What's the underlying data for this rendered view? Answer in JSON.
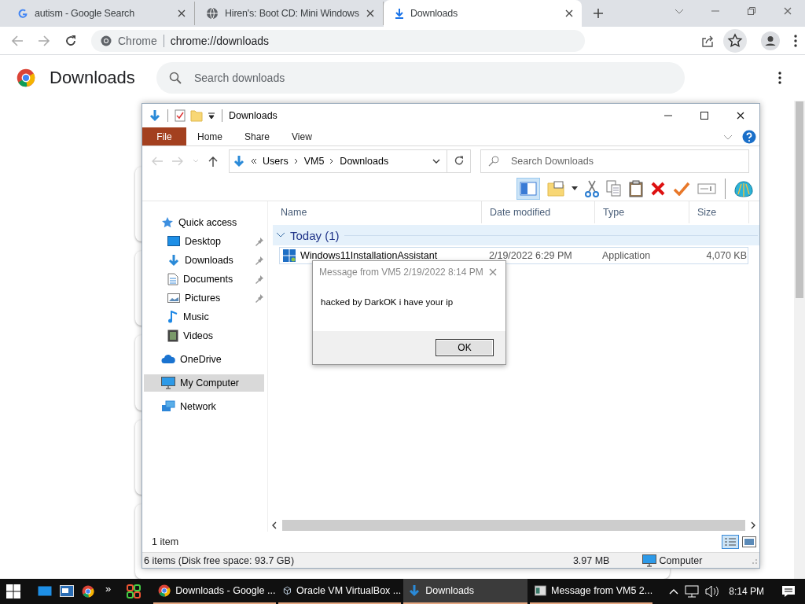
{
  "browser": {
    "tabs": [
      {
        "title": "autism - Google Search",
        "selected": false
      },
      {
        "title": "Hiren's: Boot CD: Mini Windows",
        "selected": false
      },
      {
        "title": "Downloads",
        "selected": true
      }
    ],
    "omnibox": {
      "chip": "Chrome",
      "url": "chrome://downloads"
    },
    "page": {
      "title": "Downloads",
      "search": {
        "placeholder": "Search downloads"
      }
    }
  },
  "explorer": {
    "title": "Downloads",
    "ribbon_tabs": [
      {
        "label": "File",
        "kind": "file"
      },
      {
        "label": "Home",
        "kind": "tab"
      },
      {
        "label": "Share",
        "kind": "tab"
      },
      {
        "label": "View",
        "kind": "tab"
      }
    ],
    "address": {
      "crumbs": [
        "Users",
        "VM5",
        "Downloads"
      ]
    },
    "search": {
      "placeholder": "Search Downloads"
    },
    "nav": [
      {
        "label": "Quick access",
        "selected": false,
        "children": [
          {
            "label": "Desktop",
            "pinned": true,
            "selected": false
          },
          {
            "label": "Downloads",
            "pinned": true,
            "selected": false
          },
          {
            "label": "Documents",
            "pinned": true,
            "selected": false
          },
          {
            "label": "Pictures",
            "pinned": true,
            "selected": false
          },
          {
            "label": "Music",
            "pinned": false,
            "selected": false
          },
          {
            "label": "Videos",
            "pinned": false,
            "selected": false
          }
        ]
      },
      {
        "label": "OneDrive",
        "selected": false
      },
      {
        "label": "My Computer",
        "selected": true
      },
      {
        "label": "Network",
        "selected": false
      }
    ],
    "columns": [
      "Name",
      "Date modified",
      "Type",
      "Size"
    ],
    "groups": [
      {
        "label": "Today (1)",
        "expanded": true,
        "rows": [
          {
            "name": "Windows11InstallationAssistant",
            "date": "2/19/2022 6:29 PM",
            "type": "Application",
            "size": "4,070 KB"
          }
        ]
      }
    ],
    "item_count": "1 item",
    "status_bar": {
      "items": "6 items (Disk free space: 93.7 GB)",
      "size": "3.97 MB",
      "location": "Computer"
    }
  },
  "dialog": {
    "title": "Message from VM5 2/19/2022 8:14 PM",
    "message": "hacked by DarkOK i have your ip",
    "button": "OK"
  },
  "taskbar": {
    "overflow": "»",
    "buttons": [
      {
        "label": "Downloads - Google ...",
        "active": false
      },
      {
        "label": "Oracle VM VirtualBox ...",
        "active": false
      },
      {
        "label": "Downloads",
        "active": true
      },
      {
        "label": "Message from VM5 2...",
        "active": false
      }
    ],
    "clock": "8:14 PM"
  }
}
